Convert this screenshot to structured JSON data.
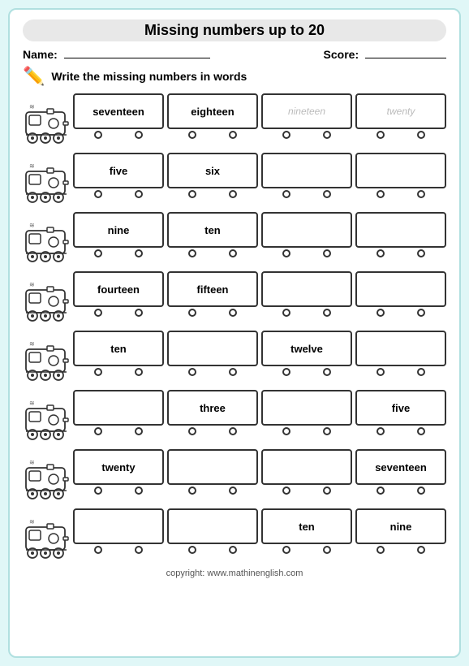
{
  "title": "Missing numbers up to 20",
  "name_label": "Name:",
  "score_label": "Score:",
  "instruction": "Write the missing numbers in words",
  "rows": [
    {
      "cars": [
        {
          "text": "seventeen",
          "placeholder": false
        },
        {
          "text": "eighteen",
          "placeholder": false
        },
        {
          "text": "nineteen",
          "placeholder": true
        },
        {
          "text": "twenty",
          "placeholder": true
        }
      ]
    },
    {
      "cars": [
        {
          "text": "five",
          "placeholder": false
        },
        {
          "text": "six",
          "placeholder": false
        },
        {
          "text": "",
          "placeholder": false
        },
        {
          "text": "",
          "placeholder": false
        }
      ]
    },
    {
      "cars": [
        {
          "text": "nine",
          "placeholder": false
        },
        {
          "text": "ten",
          "placeholder": false
        },
        {
          "text": "",
          "placeholder": false
        },
        {
          "text": "",
          "placeholder": false
        }
      ]
    },
    {
      "cars": [
        {
          "text": "fourteen",
          "placeholder": false
        },
        {
          "text": "fifteen",
          "placeholder": false
        },
        {
          "text": "",
          "placeholder": false
        },
        {
          "text": "",
          "placeholder": false
        }
      ]
    },
    {
      "cars": [
        {
          "text": "ten",
          "placeholder": false
        },
        {
          "text": "",
          "placeholder": false
        },
        {
          "text": "twelve",
          "placeholder": false
        },
        {
          "text": "",
          "placeholder": false
        }
      ]
    },
    {
      "cars": [
        {
          "text": "",
          "placeholder": false
        },
        {
          "text": "three",
          "placeholder": false
        },
        {
          "text": "",
          "placeholder": false
        },
        {
          "text": "five",
          "placeholder": false
        }
      ]
    },
    {
      "cars": [
        {
          "text": "twenty",
          "placeholder": false
        },
        {
          "text": "",
          "placeholder": false
        },
        {
          "text": "",
          "placeholder": false
        },
        {
          "text": "seventeen",
          "placeholder": false
        }
      ]
    },
    {
      "cars": [
        {
          "text": "",
          "placeholder": false
        },
        {
          "text": "",
          "placeholder": false
        },
        {
          "text": "ten",
          "placeholder": false
        },
        {
          "text": "nine",
          "placeholder": false
        }
      ]
    }
  ],
  "footer": "copyright:   www.mathinenglish.com"
}
